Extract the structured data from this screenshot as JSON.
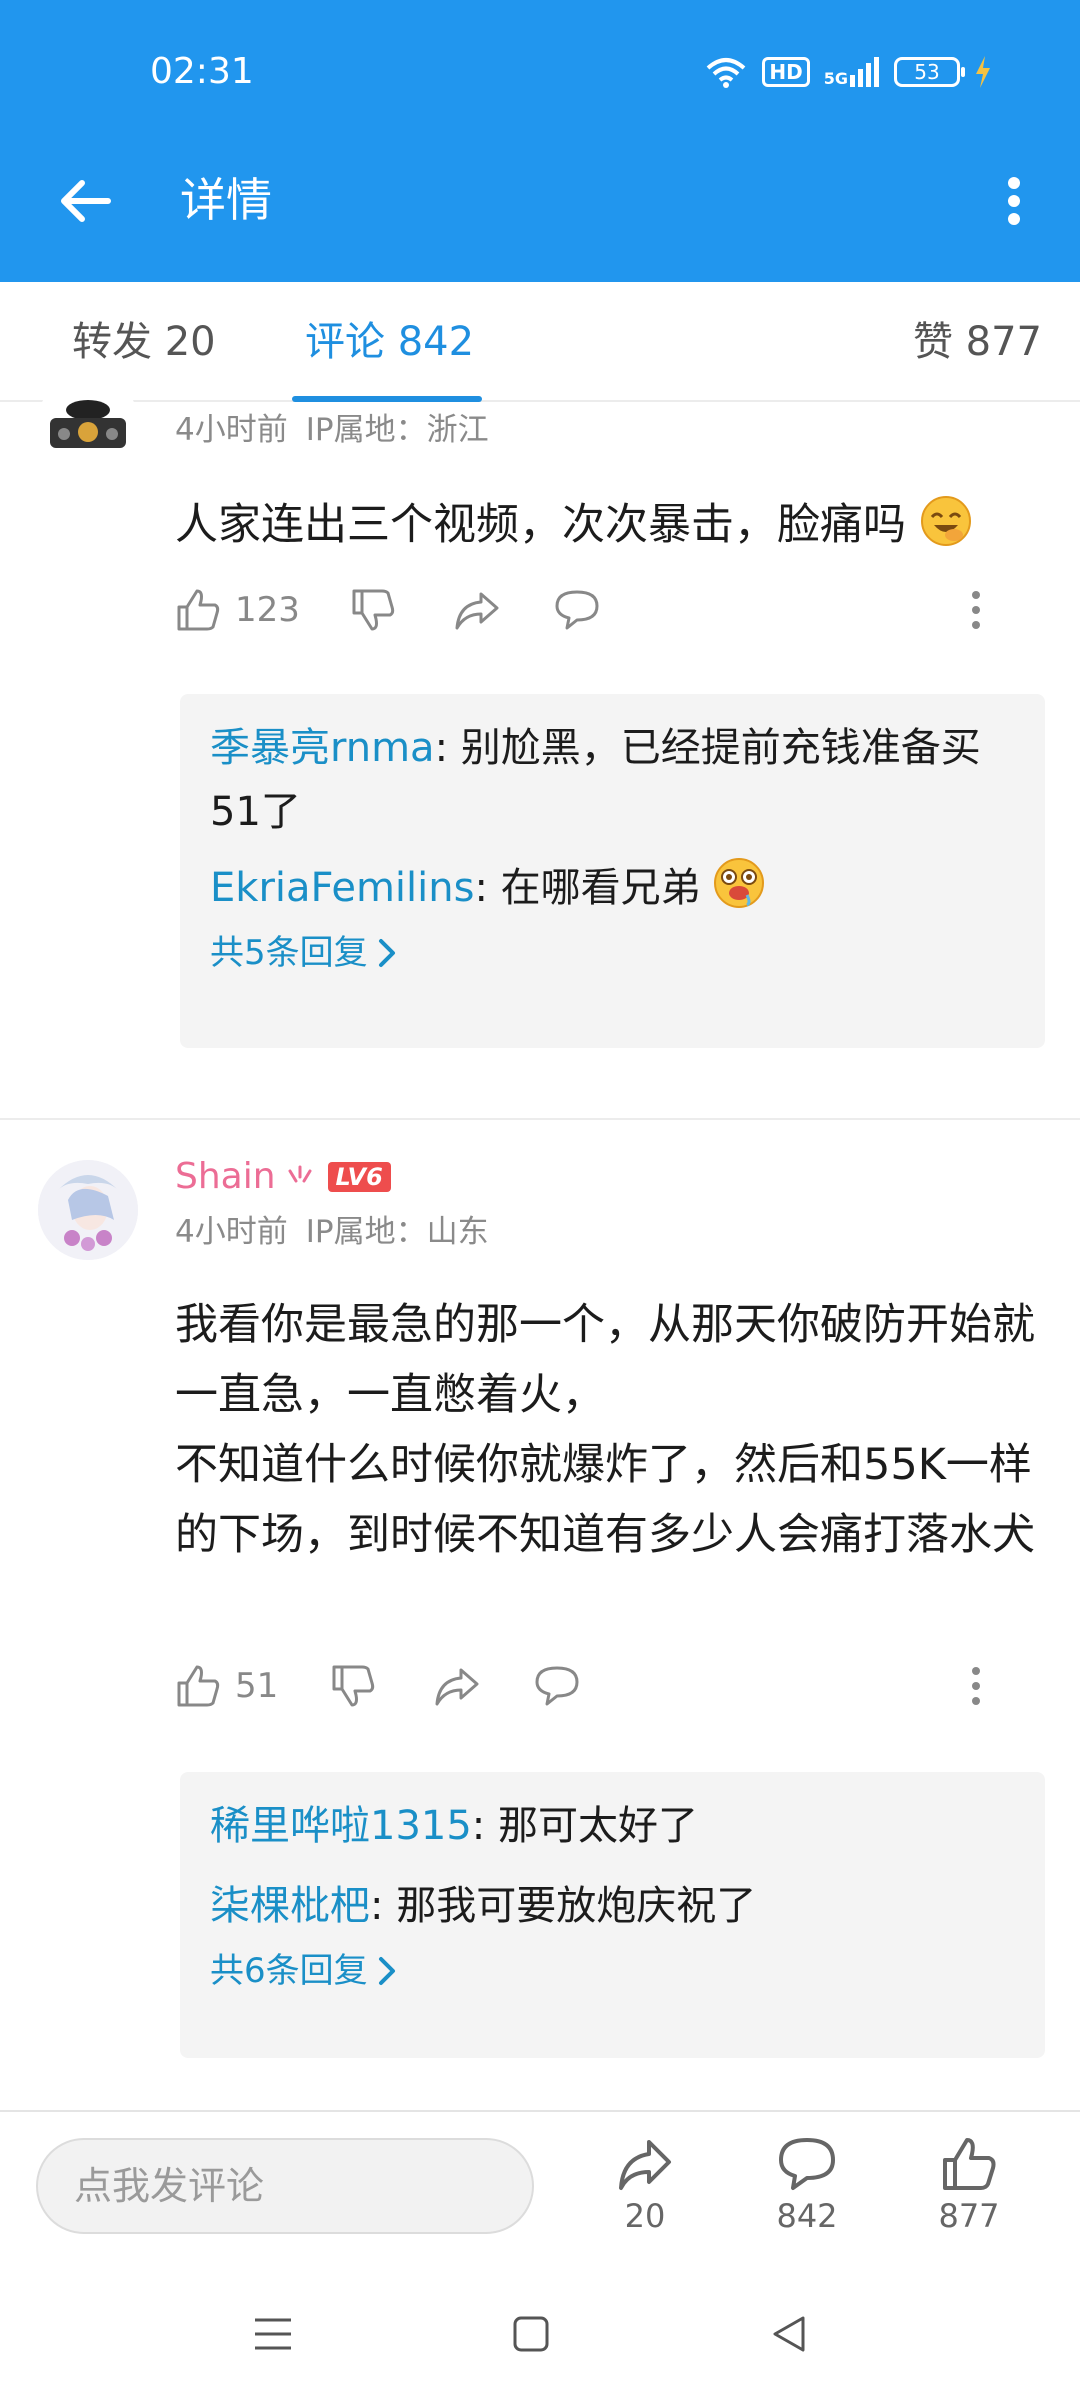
{
  "status_bar": {
    "time": "02:31",
    "hd": "HD",
    "network": "5G",
    "battery": "53"
  },
  "header": {
    "title": "详情"
  },
  "tabs": {
    "repost": "转发 20",
    "comments": "评论 842",
    "likes": "赞 877"
  },
  "comments": [
    {
      "time": "4小时前",
      "ip": "IP属地：浙江",
      "text": "人家连出三个视频，次次暴击，脸痛吗",
      "emoji": "laughing-face",
      "likes": "123",
      "replies": [
        {
          "name": "季暴亮rnma",
          "text": ": 别尬黑，已经提前充钱准备买51了"
        },
        {
          "name": "EkriaFemilins",
          "text": ": 在哪看兄弟"
        }
      ],
      "more_replies": "共5条回复"
    },
    {
      "username": "Shain",
      "user_badge": "LV6",
      "time": "4小时前",
      "ip": "IP属地：山东",
      "text": "我看你是最急的那一个，从那天你破防开始就一直急，一直憋着火，\n不知道什么时候你就爆炸了，然后和55K一样的下场，到时候不知道有多少人会痛打落水犬",
      "likes": "51",
      "replies": [
        {
          "name": "稀里哗啦1315",
          "text": ": 那可太好了"
        },
        {
          "name": "柒棵枇杷",
          "text": ": 那我可要放炮庆祝了"
        }
      ],
      "more_replies": "共6条回复"
    }
  ],
  "bottom_bar": {
    "input_placeholder": "点我发评论",
    "share_count": "20",
    "comment_count": "842",
    "like_count": "877"
  },
  "colors": {
    "primary": "#2196ee",
    "link": "#1a8fc7",
    "username": "#ec6d95",
    "badge": "#ee4d4d"
  }
}
